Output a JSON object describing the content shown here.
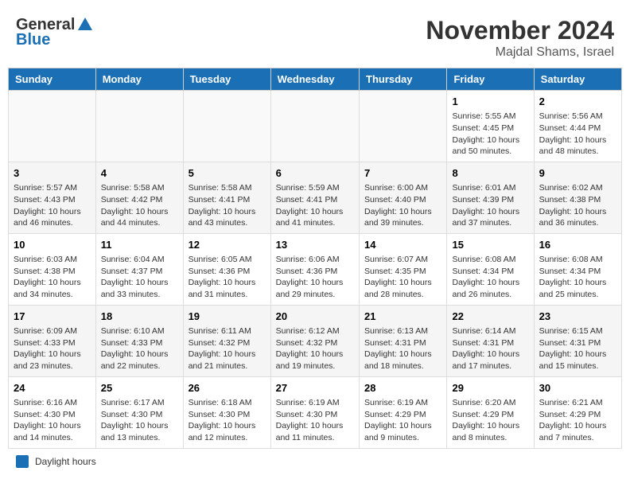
{
  "logo": {
    "general": "General",
    "blue": "Blue"
  },
  "header": {
    "month": "November 2024",
    "location": "Majdal Shams, Israel"
  },
  "weekdays": [
    "Sunday",
    "Monday",
    "Tuesday",
    "Wednesday",
    "Thursday",
    "Friday",
    "Saturday"
  ],
  "weeks": [
    [
      {
        "day": "",
        "info": ""
      },
      {
        "day": "",
        "info": ""
      },
      {
        "day": "",
        "info": ""
      },
      {
        "day": "",
        "info": ""
      },
      {
        "day": "",
        "info": ""
      },
      {
        "day": "1",
        "info": "Sunrise: 5:55 AM\nSunset: 4:45 PM\nDaylight: 10 hours and 50 minutes."
      },
      {
        "day": "2",
        "info": "Sunrise: 5:56 AM\nSunset: 4:44 PM\nDaylight: 10 hours and 48 minutes."
      }
    ],
    [
      {
        "day": "3",
        "info": "Sunrise: 5:57 AM\nSunset: 4:43 PM\nDaylight: 10 hours and 46 minutes."
      },
      {
        "day": "4",
        "info": "Sunrise: 5:58 AM\nSunset: 4:42 PM\nDaylight: 10 hours and 44 minutes."
      },
      {
        "day": "5",
        "info": "Sunrise: 5:58 AM\nSunset: 4:41 PM\nDaylight: 10 hours and 43 minutes."
      },
      {
        "day": "6",
        "info": "Sunrise: 5:59 AM\nSunset: 4:41 PM\nDaylight: 10 hours and 41 minutes."
      },
      {
        "day": "7",
        "info": "Sunrise: 6:00 AM\nSunset: 4:40 PM\nDaylight: 10 hours and 39 minutes."
      },
      {
        "day": "8",
        "info": "Sunrise: 6:01 AM\nSunset: 4:39 PM\nDaylight: 10 hours and 37 minutes."
      },
      {
        "day": "9",
        "info": "Sunrise: 6:02 AM\nSunset: 4:38 PM\nDaylight: 10 hours and 36 minutes."
      }
    ],
    [
      {
        "day": "10",
        "info": "Sunrise: 6:03 AM\nSunset: 4:38 PM\nDaylight: 10 hours and 34 minutes."
      },
      {
        "day": "11",
        "info": "Sunrise: 6:04 AM\nSunset: 4:37 PM\nDaylight: 10 hours and 33 minutes."
      },
      {
        "day": "12",
        "info": "Sunrise: 6:05 AM\nSunset: 4:36 PM\nDaylight: 10 hours and 31 minutes."
      },
      {
        "day": "13",
        "info": "Sunrise: 6:06 AM\nSunset: 4:36 PM\nDaylight: 10 hours and 29 minutes."
      },
      {
        "day": "14",
        "info": "Sunrise: 6:07 AM\nSunset: 4:35 PM\nDaylight: 10 hours and 28 minutes."
      },
      {
        "day": "15",
        "info": "Sunrise: 6:08 AM\nSunset: 4:34 PM\nDaylight: 10 hours and 26 minutes."
      },
      {
        "day": "16",
        "info": "Sunrise: 6:08 AM\nSunset: 4:34 PM\nDaylight: 10 hours and 25 minutes."
      }
    ],
    [
      {
        "day": "17",
        "info": "Sunrise: 6:09 AM\nSunset: 4:33 PM\nDaylight: 10 hours and 23 minutes."
      },
      {
        "day": "18",
        "info": "Sunrise: 6:10 AM\nSunset: 4:33 PM\nDaylight: 10 hours and 22 minutes."
      },
      {
        "day": "19",
        "info": "Sunrise: 6:11 AM\nSunset: 4:32 PM\nDaylight: 10 hours and 21 minutes."
      },
      {
        "day": "20",
        "info": "Sunrise: 6:12 AM\nSunset: 4:32 PM\nDaylight: 10 hours and 19 minutes."
      },
      {
        "day": "21",
        "info": "Sunrise: 6:13 AM\nSunset: 4:31 PM\nDaylight: 10 hours and 18 minutes."
      },
      {
        "day": "22",
        "info": "Sunrise: 6:14 AM\nSunset: 4:31 PM\nDaylight: 10 hours and 17 minutes."
      },
      {
        "day": "23",
        "info": "Sunrise: 6:15 AM\nSunset: 4:31 PM\nDaylight: 10 hours and 15 minutes."
      }
    ],
    [
      {
        "day": "24",
        "info": "Sunrise: 6:16 AM\nSunset: 4:30 PM\nDaylight: 10 hours and 14 minutes."
      },
      {
        "day": "25",
        "info": "Sunrise: 6:17 AM\nSunset: 4:30 PM\nDaylight: 10 hours and 13 minutes."
      },
      {
        "day": "26",
        "info": "Sunrise: 6:18 AM\nSunset: 4:30 PM\nDaylight: 10 hours and 12 minutes."
      },
      {
        "day": "27",
        "info": "Sunrise: 6:19 AM\nSunset: 4:30 PM\nDaylight: 10 hours and 11 minutes."
      },
      {
        "day": "28",
        "info": "Sunrise: 6:19 AM\nSunset: 4:29 PM\nDaylight: 10 hours and 9 minutes."
      },
      {
        "day": "29",
        "info": "Sunrise: 6:20 AM\nSunset: 4:29 PM\nDaylight: 10 hours and 8 minutes."
      },
      {
        "day": "30",
        "info": "Sunrise: 6:21 AM\nSunset: 4:29 PM\nDaylight: 10 hours and 7 minutes."
      }
    ]
  ],
  "legend": {
    "daylight_label": "Daylight hours"
  }
}
